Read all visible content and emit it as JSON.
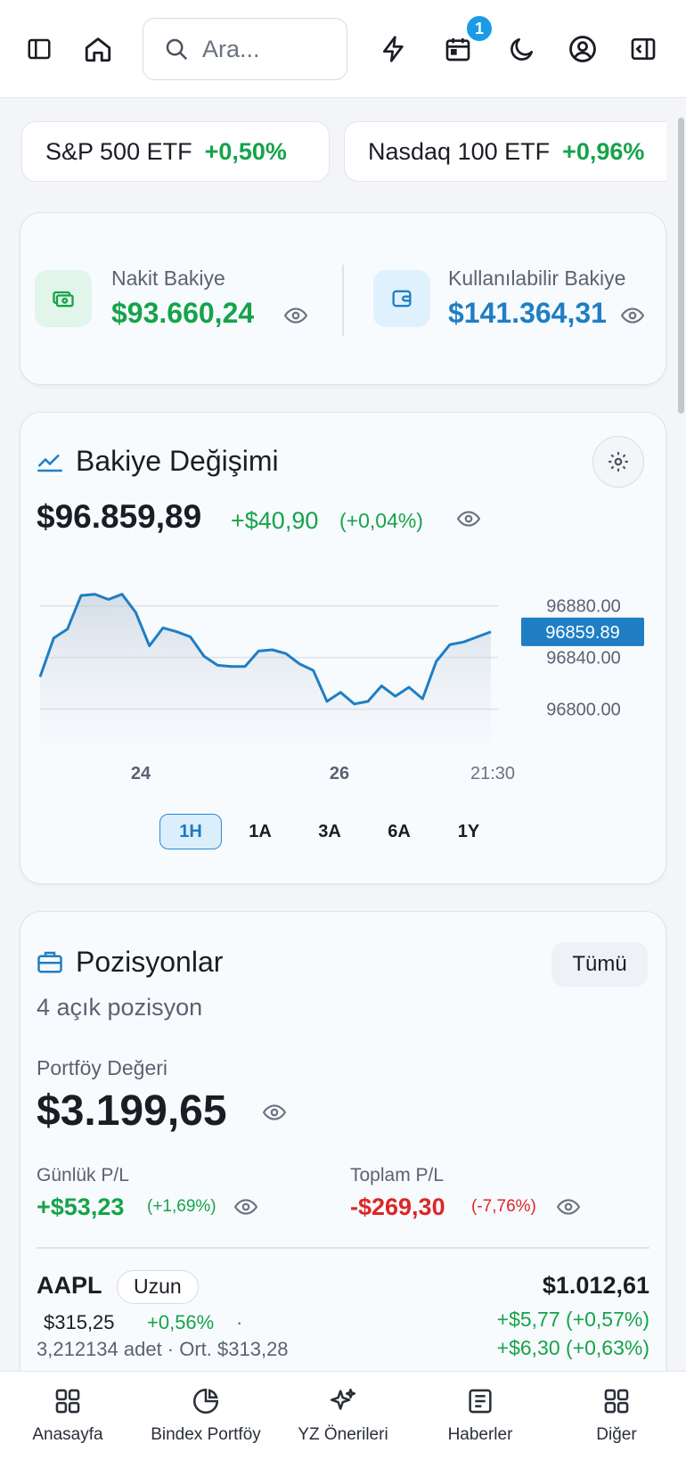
{
  "topbar": {
    "search_placeholder": "Ara...",
    "notification_count": "1"
  },
  "tickers": [
    {
      "name": "S&P 500 ETF",
      "change": "+0,50%"
    },
    {
      "name": "Nasdaq 100 ETF",
      "change": "+0,96%"
    }
  ],
  "balances": {
    "cash_label": "Nakit Bakiye",
    "cash_value": "$93.660,24",
    "available_label": "Kullanılabilir Bakiye",
    "available_value": "$141.364,31"
  },
  "balance_change": {
    "title": "Bakiye Değişimi",
    "value": "$96.859,89",
    "change": "+$40,90",
    "change_pct": "(+0,04%)",
    "ranges": [
      "1H",
      "1A",
      "3A",
      "6A",
      "1Y"
    ],
    "active_range": "1H"
  },
  "chart_data": {
    "type": "area",
    "x_tick_labels": [
      "24",
      "26",
      "21:30"
    ],
    "y_tick_labels": [
      "96880.00",
      "96840.00",
      "96800.00"
    ],
    "current_value_label": "96859.89",
    "ylim": [
      96788,
      96895
    ],
    "y": [
      96825,
      96855,
      96862,
      96888,
      96889,
      96885,
      96889,
      96875,
      96849,
      96863,
      96860,
      96856,
      96841,
      96834,
      96833,
      96833,
      96845,
      96846,
      96843,
      96835,
      96830,
      96806,
      96813,
      96804,
      96806,
      96818,
      96810,
      96817,
      96808,
      96837,
      96850,
      96852,
      96856,
      96859.89
    ],
    "accent": "#1f7ec4"
  },
  "positions": {
    "title": "Pozisyonlar",
    "all_label": "Tümü",
    "subtitle": "4 açık pozisyon",
    "portfolio_label": "Portföy Değeri",
    "portfolio_value": "$3.199,65",
    "daily_label": "Günlük P/L",
    "daily_value": "+$53,23",
    "daily_pct": "(+1,69%)",
    "total_label": "Toplam P/L",
    "total_value": "-$269,30",
    "total_pct": "(-7,76%)",
    "items": [
      {
        "symbol": "AAPL",
        "side": "Uzun",
        "price": "$315,25",
        "price_change": "+0,56%",
        "sep": "·",
        "details": "3,212134 adet · Ort. $313,28",
        "value": "$1.012,61",
        "pl1": "+$5,77 (+0,57%)",
        "pl2": "+$6,30 (+0,63%)"
      }
    ]
  },
  "nav": [
    {
      "label": "Anasayfa",
      "icon": "grid-icon"
    },
    {
      "label": "Bindex Portföy",
      "icon": "pie-chart-icon"
    },
    {
      "label": "YZ Önerileri",
      "icon": "sparkles-icon"
    },
    {
      "label": "Haberler",
      "icon": "newspaper-icon"
    },
    {
      "label": "Diğer",
      "icon": "grid-icon"
    }
  ]
}
